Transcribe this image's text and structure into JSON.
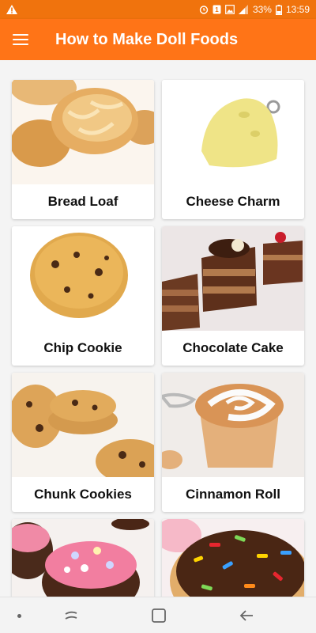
{
  "status_bar": {
    "warning_icon": "warning-triangle-icon",
    "battery_percent": "33%",
    "time": "13:59"
  },
  "app_bar": {
    "title": "How to Make Doll Foods",
    "menu_icon": "hamburger-menu-icon"
  },
  "foods": [
    {
      "label": "Bread Loaf"
    },
    {
      "label": "Cheese Charm"
    },
    {
      "label": "Chip Cookie"
    },
    {
      "label": "Chocolate Cake"
    },
    {
      "label": "Chunk Cookies"
    },
    {
      "label": "Cinnamon Roll"
    },
    {
      "label": ""
    },
    {
      "label": ""
    }
  ],
  "colors": {
    "app_bar": "#ff7417",
    "status_bar": "#f0730d",
    "background": "#f4f4f4"
  }
}
